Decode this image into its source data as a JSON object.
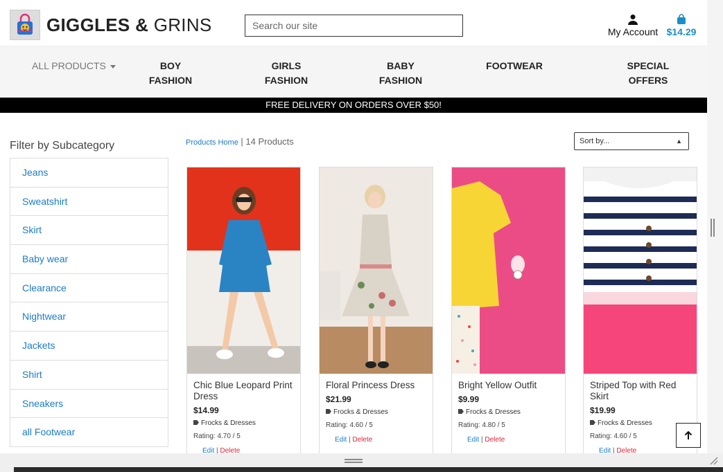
{
  "brand": {
    "name_bold": "GIGGLES &",
    "name_light": "GRINS"
  },
  "search": {
    "placeholder": "Search our site"
  },
  "account": {
    "label": "My Account"
  },
  "bag": {
    "total": "$14.29"
  },
  "nav": {
    "all_products": "ALL PRODUCTS",
    "boy_line1": "BOY",
    "boy_line2": "FASHION",
    "girls_line1": "GIRLS",
    "girls_line2": "FASHION",
    "baby_line1": "BABY",
    "baby_line2": "FASHION",
    "footwear": "FOOTWEAR",
    "special_line1": "SPECIAL",
    "special_line2": "OFFERS"
  },
  "banner": {
    "text": "FREE DELIVERY ON ORDERS OVER $50!"
  },
  "sidebar": {
    "title": "Filter by Subcategory",
    "items": [
      "Jeans",
      "Sweatshirt",
      "Skirt",
      "Baby wear",
      "Clearance",
      "Nightwear",
      "Jackets",
      "Shirt",
      "Sneakers",
      "all Footwear"
    ]
  },
  "breadcrumb": {
    "home": "Products Home",
    "separator": " | ",
    "count": "14 Products"
  },
  "sort": {
    "selected": "Sort by..."
  },
  "products": [
    {
      "name": "Chic Blue Leopard Print Dress",
      "price": "$14.99",
      "category": "Frocks & Dresses",
      "rating": "Rating: 4.70 / 5"
    },
    {
      "name": "Floral Princess Dress",
      "price": "$21.99",
      "category": "Frocks & Dresses",
      "rating": "Rating: 4.60 / 5"
    },
    {
      "name": "Bright Yellow Outfit",
      "price": "$9.99",
      "category": "Frocks & Dresses",
      "rating": "Rating: 4.80 / 5"
    },
    {
      "name": "Striped Top with Red Skirt",
      "price": "$19.99",
      "category": "Frocks & Dresses",
      "rating": "Rating: 4.60 / 5"
    }
  ],
  "card_actions": {
    "edit": "Edit",
    "sep": " | ",
    "delete": "Delete"
  },
  "colors": {
    "accent": "#1a7cc7",
    "delete": "#d9253a",
    "banner_bg": "#000000"
  }
}
